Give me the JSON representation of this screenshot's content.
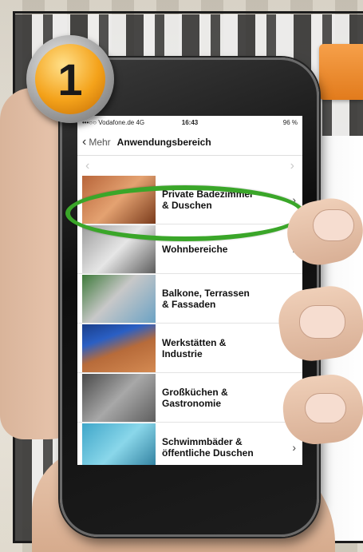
{
  "status_bar": {
    "carrier": "•••○○ Vodafone.de  4G",
    "time": "16:43",
    "battery": "96 %"
  },
  "nav": {
    "back_label": "Mehr",
    "title": "Anwendungsbereich"
  },
  "step_badge": "1",
  "list_items": [
    {
      "label_line1": "Private Badezimmer",
      "label_line2": "& Duschen",
      "highlighted": true
    },
    {
      "label_line1": "Wohnbereiche",
      "label_line2": ""
    },
    {
      "label_line1": "Balkone, Terrassen",
      "label_line2": "& Fassaden"
    },
    {
      "label_line1": "Werkstätten &",
      "label_line2": "Industrie"
    },
    {
      "label_line1": "Großküchen &",
      "label_line2": "Gastronomie"
    },
    {
      "label_line1": "Schwimmbäder &",
      "label_line2": "öffentliche Duschen"
    }
  ],
  "colors": {
    "highlight": "#3aa629",
    "badge": "#f4a21a",
    "accent_tab": "#e27b1c"
  }
}
